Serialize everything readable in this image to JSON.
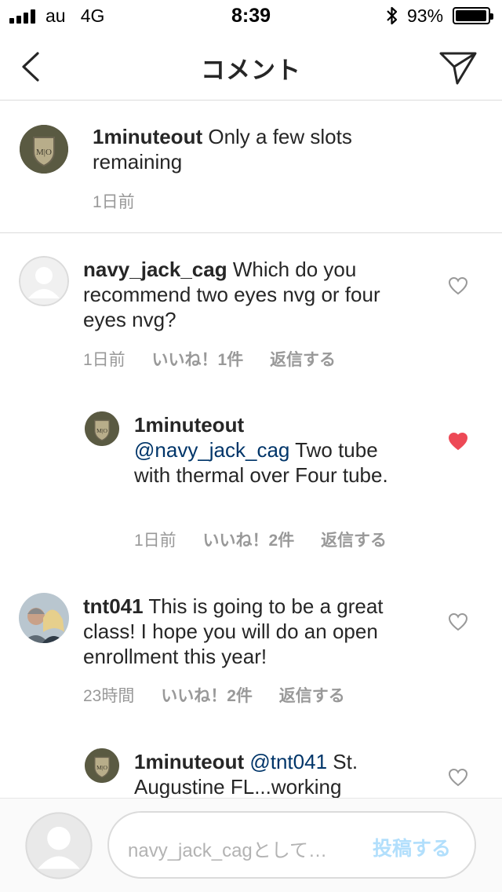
{
  "status_bar": {
    "carrier": "au",
    "network": "4G",
    "time": "8:39",
    "battery_percent": "93%",
    "signal_bars": 4
  },
  "header": {
    "title": "コメント",
    "back_icon": "chevron-left-icon",
    "share_icon": "paper-plane-icon"
  },
  "caption": {
    "username": "1minuteout",
    "text": "Only a few slots remaining",
    "time": "1日前"
  },
  "comments": [
    {
      "username": "navy_jack_cag",
      "text": "Which do you recommend two eyes nvg or four eyes nvg?",
      "time": "1日前",
      "likes": "いいね！1件",
      "reply": "返信する",
      "liked": false
    },
    {
      "username": "1minuteout",
      "mention": "@navy_jack_cag",
      "text": "Two tube with thermal over Four tube.",
      "time": "1日前",
      "likes": "いいね！2件",
      "reply": "返信する",
      "liked": true
    },
    {
      "username": "tnt041",
      "text": "This is going to be a great class! I hope you will do an open enrollment this year!",
      "time": "23時間",
      "likes": "いいね！2件",
      "reply": "返信する",
      "liked": false
    },
    {
      "username": "1minuteout",
      "mention": "@tnt041",
      "text": "St. Augustine FL...working",
      "liked": false
    }
  ],
  "composer": {
    "placeholder": "navy_jack_cagとして…",
    "post_label": "投稿する"
  },
  "colors": {
    "liked_heart": "#ed4956",
    "mention": "#003569",
    "post_disabled": "#b2dffc",
    "meta_gray": "#999999"
  }
}
